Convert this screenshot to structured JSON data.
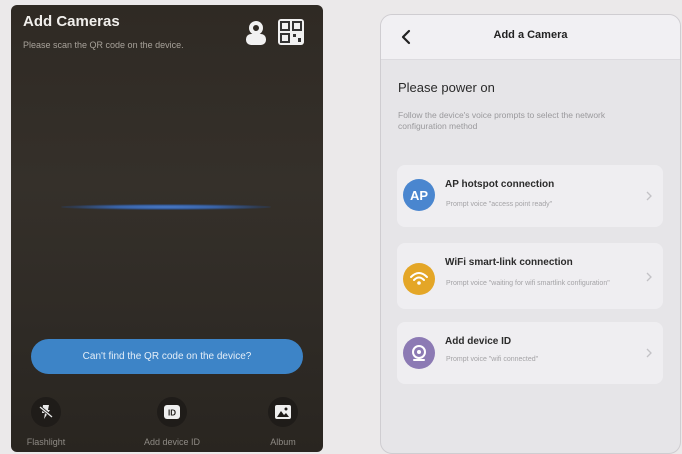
{
  "left_screen": {
    "title": "Add Cameras",
    "subtitle": "Please scan the QR code on the device.",
    "icons": {
      "person": "person-icon",
      "qr": "qr-code-icon"
    },
    "cant_find_button": "Can't find the QR code on the device?",
    "tools": [
      {
        "label": "Flashlight",
        "icon": "flashlight-off-icon"
      },
      {
        "label": "Add device ID",
        "icon": "id-icon"
      },
      {
        "label": "Album",
        "icon": "album-icon"
      }
    ],
    "colors": {
      "background": "#322d27",
      "button": "#3d84c7",
      "scan_line": "#4a7bc9"
    }
  },
  "right_screen": {
    "title": "Add a Camera",
    "back_icon": "chevron-left-icon",
    "heading": "Please power on",
    "description": "Follow the device's voice prompts to select the network configuration method",
    "options": [
      {
        "icon_text": "AP",
        "icon": "ap-icon",
        "title": "AP hotspot connection",
        "desc": "Prompt voice \"access point ready\"",
        "color": "#4a86cf"
      },
      {
        "icon": "wifi-icon",
        "title": "WiFi smart-link connection",
        "desc": "Prompt voice \"waiting for wifi smartlink configuration\"",
        "color": "#e4a627"
      },
      {
        "icon": "device-id-icon",
        "title": "Add device ID",
        "desc": "Prompt voice \"wifi connected\"",
        "color": "#8c7ab4"
      }
    ]
  }
}
